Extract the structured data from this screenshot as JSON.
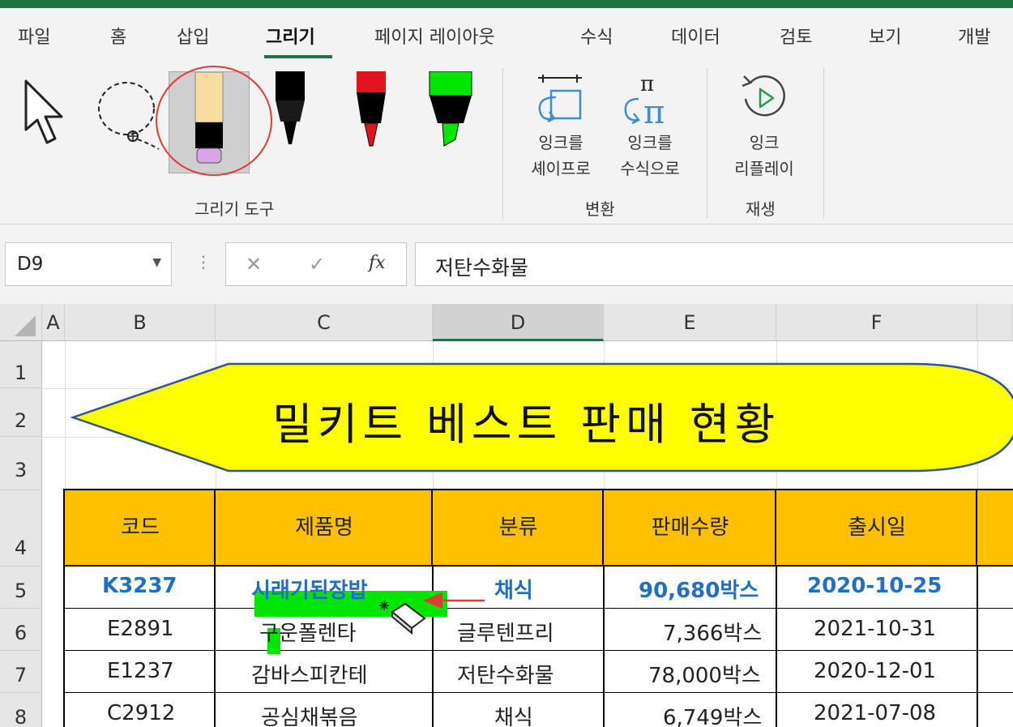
{
  "ribbon_tabs": [
    "파일",
    "홈",
    "삽입",
    "그리기",
    "페이지 레이아웃",
    "수식",
    "데이터",
    "검토",
    "보기",
    "개발"
  ],
  "active_tab": "그리기",
  "ribbon": {
    "group_draw_tools": "그리기 도구",
    "group_convert": "변환",
    "group_replay": "재생",
    "ink_to_shape_l1": "잉크를",
    "ink_to_shape_l2": "셰이프로",
    "ink_to_math_l1": "잉크를",
    "ink_to_math_l2": "수식으로",
    "ink_replay_l1": "잉크",
    "ink_replay_l2": "리플레이",
    "pen_colors": [
      "#000000",
      "#e0141e",
      "#00e600"
    ]
  },
  "formula_bar": {
    "name_box": "D9",
    "fx_label": "fx",
    "formula": "저탄수화물"
  },
  "columns": [
    "A",
    "B",
    "C",
    "D",
    "E",
    "F"
  ],
  "rows": [
    "1",
    "2",
    "3",
    "4",
    "5",
    "6",
    "7",
    "8"
  ],
  "banner_title": "밀키트 베스트 판매 현황",
  "table": {
    "headers": [
      "코드",
      "제품명",
      "분류",
      "판매수량",
      "출시일"
    ],
    "rows": [
      [
        "K3237",
        "시래기된장밥",
        "채식",
        "90,680박스",
        "2020-10-25"
      ],
      [
        "E2891",
        "구운폴렌타",
        "글루텐프리",
        "7,366박스",
        "2021-10-31"
      ],
      [
        "E1237",
        "감바스피칸테",
        "저탄수화물",
        "78,000박스",
        "2020-12-01"
      ],
      [
        "C2912",
        "공심채볶음",
        "채식",
        "6,749박스",
        "2021-07-08"
      ]
    ]
  },
  "colors": {
    "accent": "#217346",
    "header_fill": "#ffc000",
    "banner_fill": "#ffff00",
    "highlight_blue": "#1f6fc5",
    "annotation_red": "#e53935",
    "highlighter_green": "#00e600"
  }
}
